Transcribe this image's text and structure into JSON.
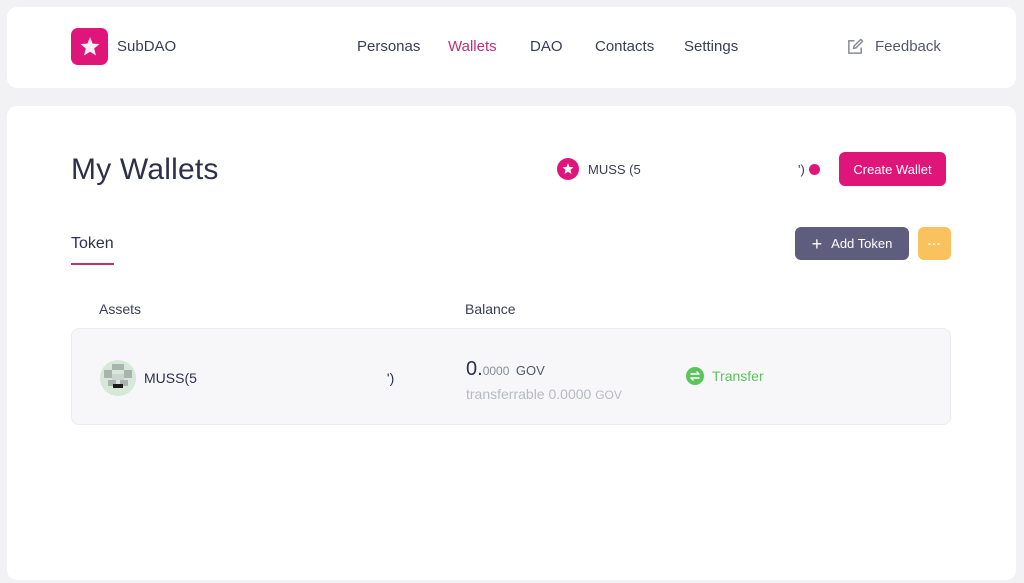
{
  "brand": {
    "name": "SubDAO",
    "icon": "star-icon"
  },
  "nav": {
    "items": [
      {
        "label": "Personas",
        "active": false
      },
      {
        "label": "Wallets",
        "active": true
      },
      {
        "label": "DAO",
        "active": false
      },
      {
        "label": "Contacts",
        "active": false
      },
      {
        "label": "Settings",
        "active": false
      }
    ],
    "feedback": {
      "label": "Feedback",
      "icon": "edit-icon"
    }
  },
  "page": {
    "title": "My Wallets",
    "account": {
      "name": "MUSS (5",
      "suffix": "')",
      "status_color": "#e0157a"
    },
    "create_wallet_label": "Create Wallet",
    "tabs": [
      {
        "label": "Token",
        "active": true
      }
    ],
    "add_token_label": "Add Token",
    "more_label": "···"
  },
  "table": {
    "columns": [
      "Assets",
      "Balance"
    ],
    "rows": [
      {
        "asset": "MUSS(5",
        "asset_suffix": "')",
        "balance_int": "0.",
        "balance_dec": "0000",
        "unit": "GOV",
        "transferrable_label": "transferrable 0.0000",
        "transferrable_unit": "GOV",
        "action_label": "Transfer"
      }
    ]
  },
  "colors": {
    "accent": "#e0157a",
    "active_nav": "#c22d79",
    "add_token_bg": "#5f5d7d",
    "more_bg": "#f9c25e",
    "transfer": "#5cc45f"
  }
}
